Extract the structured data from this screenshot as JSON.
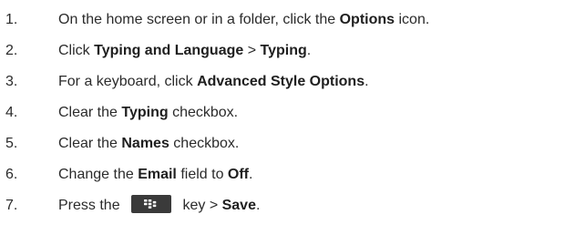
{
  "steps": [
    {
      "number": "1.",
      "parts": [
        "On the home screen or in a folder, click the ",
        "Options",
        " icon."
      ]
    },
    {
      "number": "2.",
      "parts": [
        "Click ",
        "Typing and Language",
        " > ",
        "Typing",
        "."
      ]
    },
    {
      "number": "3.",
      "parts": [
        "For a keyboard, click ",
        "Advanced Style Options",
        "."
      ]
    },
    {
      "number": "4.",
      "parts": [
        "Clear the ",
        "Typing",
        " checkbox."
      ]
    },
    {
      "number": "5.",
      "parts": [
        "Clear the ",
        "Names",
        " checkbox."
      ]
    },
    {
      "number": "6.",
      "parts": [
        "Change the ",
        "Email",
        " field to ",
        "Off",
        "."
      ]
    },
    {
      "number": "7.",
      "parts": [
        "Press the ",
        " key > ",
        "Save",
        "."
      ],
      "icon": "blackberry-menu-key-icon"
    }
  ]
}
